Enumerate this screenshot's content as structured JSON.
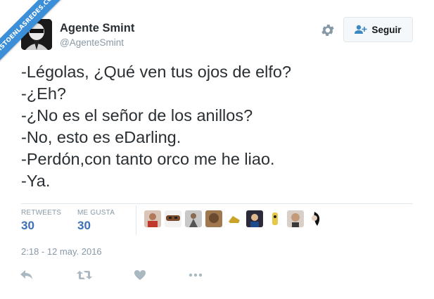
{
  "watermark": "VISTOENLASREDES.COM",
  "user": {
    "name": "Agente Smint",
    "handle": "@AgenteSmint"
  },
  "follow_button": {
    "label": "Seguir"
  },
  "tweet": {
    "lines": [
      "-Légolas, ¿Qué ven tus ojos de elfo?",
      "-¿Eh?",
      "-¿No es el señor de los anillos?",
      "-No, esto es eDarling.",
      "-Perdón,con tanto orco me he liao.",
      "-Ya."
    ]
  },
  "stats": {
    "retweets_label": "RETWEETS",
    "retweets_count": "30",
    "likes_label": "ME GUSTA",
    "likes_count": "30"
  },
  "liker_avatars": [
    "avatar-1",
    "avatar-2",
    "avatar-3",
    "avatar-4",
    "avatar-5",
    "avatar-6",
    "avatar-7",
    "avatar-8",
    "avatar-9"
  ],
  "timestamp": "2:18 - 12 may. 2016",
  "colors": {
    "accent": "#3b6fb6",
    "muted": "#8899a6",
    "ribbon": "#3b8fd9"
  }
}
